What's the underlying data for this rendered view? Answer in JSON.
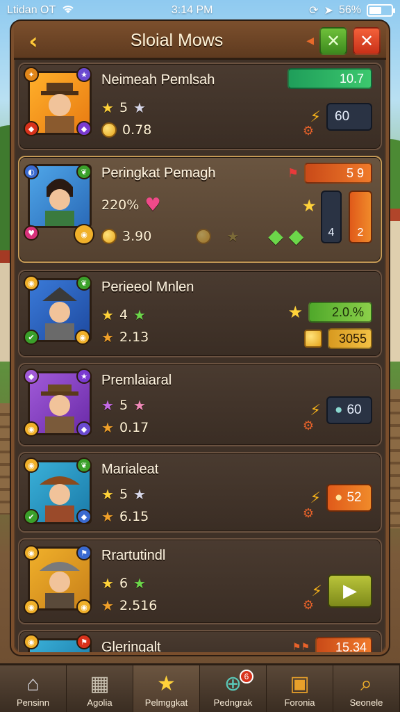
{
  "status_bar": {
    "carrier": "Ltidan OT",
    "time": "3:14 PM",
    "battery": "56%",
    "battery_level": 0.56
  },
  "header": {
    "title": "Sloial Mows"
  },
  "cards": [
    {
      "name": "Neimeah Pemlsah",
      "rank": "5",
      "score": "0.78",
      "bar_value": "10.7",
      "stat": "60"
    },
    {
      "name": "Peringkat Pemagh",
      "percent": "220%",
      "score": "3.90",
      "bar_value": "5 9",
      "stat_a": "4",
      "stat_b": "2"
    },
    {
      "name": "Perieeol Mnlen",
      "rank": "4",
      "score": "2.13",
      "bar_value": "2.0.%",
      "gold_value": "3055"
    },
    {
      "name": "Premlaiaral",
      "rank": "5",
      "score": "0.17",
      "stat": "60"
    },
    {
      "name": "Marialeat",
      "rank": "5",
      "score": "6.15",
      "stat": "52"
    },
    {
      "name": "Rrartutindl",
      "rank": "6",
      "score": "2.516"
    },
    {
      "name": "Gleringalt",
      "stat": "15.34"
    }
  ],
  "nav": [
    {
      "label": "Pensinn",
      "icon": "house-icon"
    },
    {
      "label": "Agolia",
      "icon": "map-icon"
    },
    {
      "label": "Pelmggkat",
      "icon": "star-icon"
    },
    {
      "label": "Pedngrak",
      "icon": "magnifier-icon",
      "badge": "6"
    },
    {
      "label": "Foronia",
      "icon": "chest-icon"
    },
    {
      "label": "Seonele",
      "icon": "search-icon"
    }
  ]
}
